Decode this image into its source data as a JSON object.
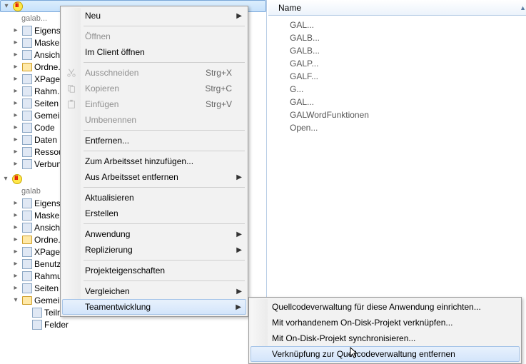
{
  "tree": {
    "app1": {
      "title": "",
      "sub": "galab..."
    },
    "items1": [
      "Eigens...",
      "Maske...",
      "Ansich...",
      "Ordne...",
      "XPage...",
      "Rahm...",
      "Seiten",
      "Gemei...",
      "Code",
      "Daten",
      "Ressou...",
      "Verbun..."
    ],
    "app2": {
      "title": "",
      "sub": "galab"
    },
    "items2": [
      "Eigens...",
      "Maske...",
      "Ansich...",
      "Ordne...",
      "XPage...",
      "Benutz...",
      "Rahmungs...",
      "Seiten"
    ],
    "shared": "Gemeinsame Elemente",
    "shared_items": [
      "Teilmasken",
      "Felder"
    ]
  },
  "right": {
    "col": "Name",
    "items": [
      "GAL...",
      "GALB...",
      "GALB...",
      "GALP...",
      "GALF...",
      "G...",
      "GAL...",
      "GALWordFunktionen",
      "Open..."
    ]
  },
  "menu": {
    "neu": "Neu",
    "oeffnen": "Öffnen",
    "im_client": "Im Client öffnen",
    "ausschneiden": "Ausschneiden",
    "kopieren": "Kopieren",
    "einfuegen": "Einfügen",
    "sc_cut": "Strg+X",
    "sc_copy": "Strg+C",
    "sc_paste": "Strg+V",
    "umbenennen": "Umbenennen",
    "entfernen": "Entfernen...",
    "ws_add": "Zum Arbeitsset hinzufügen...",
    "ws_rem": "Aus Arbeitsset entfernen",
    "aktualisieren": "Aktualisieren",
    "erstellen": "Erstellen",
    "anwendung": "Anwendung",
    "replizierung": "Replizierung",
    "projekteig": "Projekteigenschaften",
    "vergleichen": "Vergleichen",
    "team": "Teamentwicklung"
  },
  "submenu": {
    "s1": "Quellcodeverwaltung für diese Anwendung einrichten...",
    "s2": "Mit vorhandenem On-Disk-Projekt verknüpfen...",
    "s3": "Mit On-Disk-Projekt synchronisieren...",
    "s4": "Verknüpfung zur Quellcodeverwaltung entfernen"
  }
}
